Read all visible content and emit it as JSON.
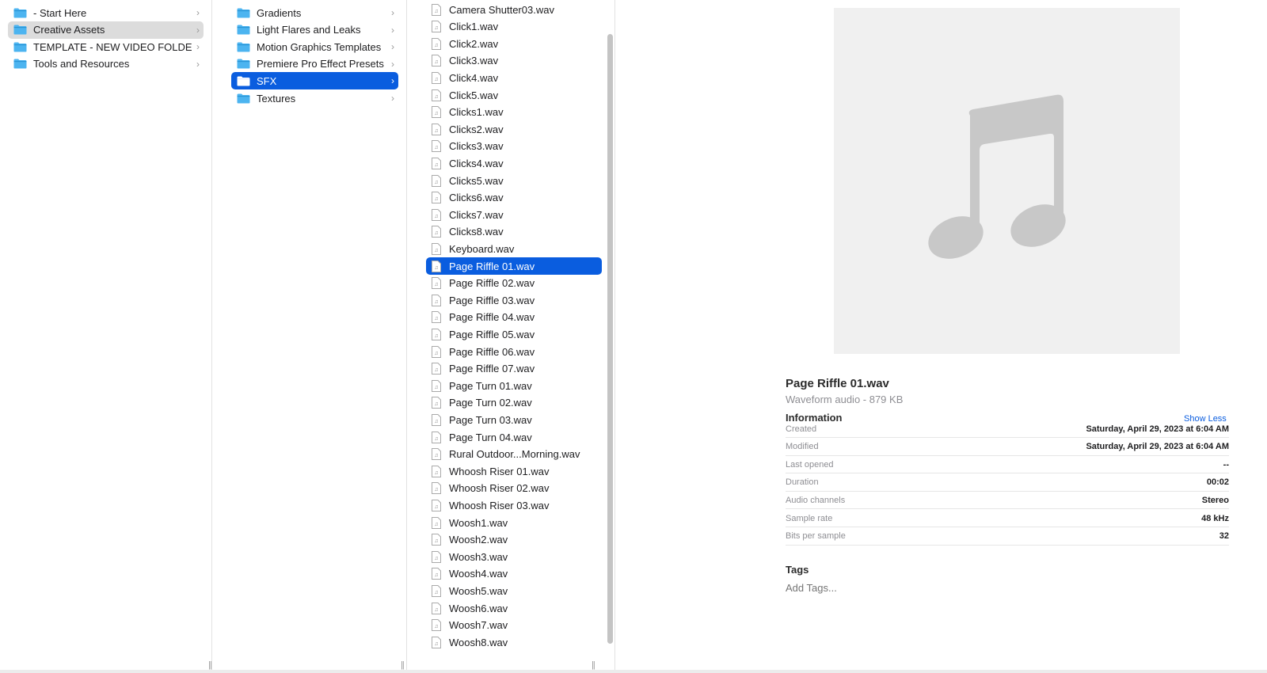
{
  "column1": {
    "items": [
      {
        "label": "- Start Here",
        "selected": false
      },
      {
        "label": "Creative Assets",
        "selected": true
      },
      {
        "label": "TEMPLATE - NEW VIDEO FOLDER",
        "selected": false
      },
      {
        "label": "Tools and Resources",
        "selected": false
      }
    ]
  },
  "column2": {
    "items": [
      {
        "label": "Gradients",
        "selected": false
      },
      {
        "label": "Light Flares and Leaks",
        "selected": false
      },
      {
        "label": "Motion Graphics Templates",
        "selected": false
      },
      {
        "label": "Premiere Pro Effect Presets",
        "selected": false
      },
      {
        "label": "SFX",
        "selected": true
      },
      {
        "label": "Textures",
        "selected": false
      }
    ]
  },
  "column3": {
    "items": [
      {
        "label": "Camera Shutter03.wav",
        "selected": false
      },
      {
        "label": "Click1.wav",
        "selected": false
      },
      {
        "label": "Click2.wav",
        "selected": false
      },
      {
        "label": "Click3.wav",
        "selected": false
      },
      {
        "label": "Click4.wav",
        "selected": false
      },
      {
        "label": "Click5.wav",
        "selected": false
      },
      {
        "label": "Clicks1.wav",
        "selected": false
      },
      {
        "label": "Clicks2.wav",
        "selected": false
      },
      {
        "label": "Clicks3.wav",
        "selected": false
      },
      {
        "label": "Clicks4.wav",
        "selected": false
      },
      {
        "label": "Clicks5.wav",
        "selected": false
      },
      {
        "label": "Clicks6.wav",
        "selected": false
      },
      {
        "label": "Clicks7.wav",
        "selected": false
      },
      {
        "label": "Clicks8.wav",
        "selected": false
      },
      {
        "label": "Keyboard.wav",
        "selected": false
      },
      {
        "label": "Page Riffle 01.wav",
        "selected": true
      },
      {
        "label": "Page Riffle 02.wav",
        "selected": false
      },
      {
        "label": "Page Riffle 03.wav",
        "selected": false
      },
      {
        "label": "Page Riffle 04.wav",
        "selected": false
      },
      {
        "label": "Page Riffle 05.wav",
        "selected": false
      },
      {
        "label": "Page Riffle 06.wav",
        "selected": false
      },
      {
        "label": "Page Riffle 07.wav",
        "selected": false
      },
      {
        "label": "Page Turn 01.wav",
        "selected": false
      },
      {
        "label": "Page Turn 02.wav",
        "selected": false
      },
      {
        "label": "Page Turn 03.wav",
        "selected": false
      },
      {
        "label": "Page Turn 04.wav",
        "selected": false
      },
      {
        "label": "Rural Outdoor...Morning.wav",
        "selected": false
      },
      {
        "label": "Whoosh Riser 01.wav",
        "selected": false
      },
      {
        "label": "Whoosh Riser 02.wav",
        "selected": false
      },
      {
        "label": "Whoosh Riser 03.wav",
        "selected": false
      },
      {
        "label": "Woosh1.wav",
        "selected": false
      },
      {
        "label": "Woosh2.wav",
        "selected": false
      },
      {
        "label": "Woosh3.wav",
        "selected": false
      },
      {
        "label": "Woosh4.wav",
        "selected": false
      },
      {
        "label": "Woosh5.wav",
        "selected": false
      },
      {
        "label": "Woosh6.wav",
        "selected": false
      },
      {
        "label": "Woosh7.wav",
        "selected": false
      },
      {
        "label": "Woosh8.wav",
        "selected": false
      }
    ]
  },
  "preview": {
    "icon": "music-note-icon",
    "title": "Page Riffle 01.wav",
    "subtitle": "Waveform audio - 879 KB",
    "info_heading": "Information",
    "show_less": "Show Less",
    "info": [
      {
        "key": "Created",
        "value": "Saturday, April 29, 2023 at 6:04 AM"
      },
      {
        "key": "Modified",
        "value": "Saturday, April 29, 2023 at 6:04 AM"
      },
      {
        "key": "Last opened",
        "value": "--"
      },
      {
        "key": "Duration",
        "value": "00:02"
      },
      {
        "key": "Audio channels",
        "value": "Stereo"
      },
      {
        "key": "Sample rate",
        "value": "48 kHz"
      },
      {
        "key": "Bits per sample",
        "value": "32"
      }
    ],
    "tags_heading": "Tags",
    "tags_placeholder": "Add Tags..."
  },
  "colors": {
    "selection_blue": "#0a5ddf",
    "selection_gray": "#dcdcdc",
    "folder_blue": "#4cb4f0",
    "link_blue": "#0a5ddf"
  }
}
